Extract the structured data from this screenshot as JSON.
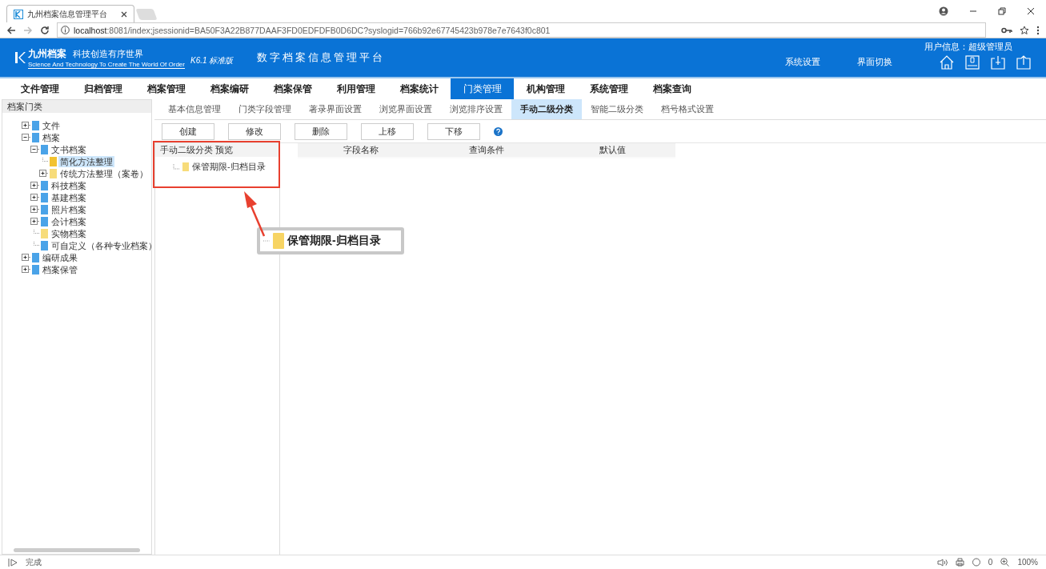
{
  "browser": {
    "tab_title": "九州档案信息管理平台",
    "url_host": "localhost",
    "url_rest": ":8081/index;jsessionid=BA50F3A22B877DAAF3FD0EDFDFB0D6DC?syslogid=766b92e67745423b978e7e7643f0c801"
  },
  "header": {
    "logo_name": "九州档案",
    "logo_slogan": "科技创造有序世界",
    "logo_tagline": "Science And Technology To Create The World Of Order",
    "version": "K6.1 标准版",
    "app_title": "数字档案信息管理平台",
    "user_info": "用户信息：超级管理员",
    "links": [
      "系统设置",
      "界面切换"
    ]
  },
  "main_nav": [
    {
      "label": "文件管理",
      "selected": false
    },
    {
      "label": "归档管理",
      "selected": false
    },
    {
      "label": "档案管理",
      "selected": false
    },
    {
      "label": "档案编研",
      "selected": false
    },
    {
      "label": "档案保管",
      "selected": false
    },
    {
      "label": "利用管理",
      "selected": false
    },
    {
      "label": "档案统计",
      "selected": false
    },
    {
      "label": "门类管理",
      "selected": true
    },
    {
      "label": "机构管理",
      "selected": false
    },
    {
      "label": "系统管理",
      "selected": false
    },
    {
      "label": "档案查询",
      "selected": false
    }
  ],
  "sidebar": {
    "title": "档案门类",
    "tree": [
      {
        "label": "文件",
        "color": "#4aa3e8",
        "expanded": false,
        "selected": false
      },
      {
        "label": "档案",
        "color": "#4aa3e8",
        "expanded": true,
        "selected": false,
        "children": [
          {
            "label": "文书档案",
            "color": "#4aa3e8",
            "expanded": true,
            "selected": false,
            "children": [
              {
                "label": "简化方法整理",
                "color": "#f2c230",
                "selected": true
              },
              {
                "label": "传统方法整理（案卷）",
                "color": "#f7dc7a",
                "expanded": false,
                "selected": false
              }
            ]
          },
          {
            "label": "科技档案",
            "color": "#4aa3e8",
            "expanded": false,
            "selected": false
          },
          {
            "label": "基建档案",
            "color": "#4aa3e8",
            "expanded": false,
            "selected": false
          },
          {
            "label": "照片档案",
            "color": "#4aa3e8",
            "expanded": false,
            "selected": false
          },
          {
            "label": "会计档案",
            "color": "#4aa3e8",
            "expanded": false,
            "selected": false
          },
          {
            "label": "实物档案",
            "color": "#f7dc7a",
            "selected": false
          },
          {
            "label": "可自定义（各种专业档案）",
            "color": "#4aa3e8",
            "selected": false
          }
        ]
      },
      {
        "label": "编研成果",
        "color": "#4aa3e8",
        "expanded": false,
        "selected": false
      },
      {
        "label": "档案保管",
        "color": "#4aa3e8",
        "expanded": false,
        "selected": false
      }
    ]
  },
  "sub_tabs": [
    {
      "label": "基本信息管理",
      "selected": false
    },
    {
      "label": "门类字段管理",
      "selected": false
    },
    {
      "label": "著录界面设置",
      "selected": false
    },
    {
      "label": "浏览界面设置",
      "selected": false
    },
    {
      "label": "浏览排序设置",
      "selected": false
    },
    {
      "label": "手动二级分类",
      "selected": true
    },
    {
      "label": "智能二级分类",
      "selected": false
    },
    {
      "label": "档号格式设置",
      "selected": false
    }
  ],
  "toolbar": {
    "buttons": [
      "创建",
      "修改",
      "删除",
      "上移",
      "下移"
    ]
  },
  "preview": {
    "title": "手动二级分类 预览",
    "items": [
      {
        "label": "保管期限-归档目录"
      }
    ]
  },
  "grid": {
    "columns": [
      "字段名称",
      "查询条件",
      "默认值"
    ]
  },
  "callout": {
    "label": "保管期限-归档目录"
  },
  "status_bar": {
    "text": "完成",
    "badge_count": "0",
    "zoom": "100%"
  }
}
